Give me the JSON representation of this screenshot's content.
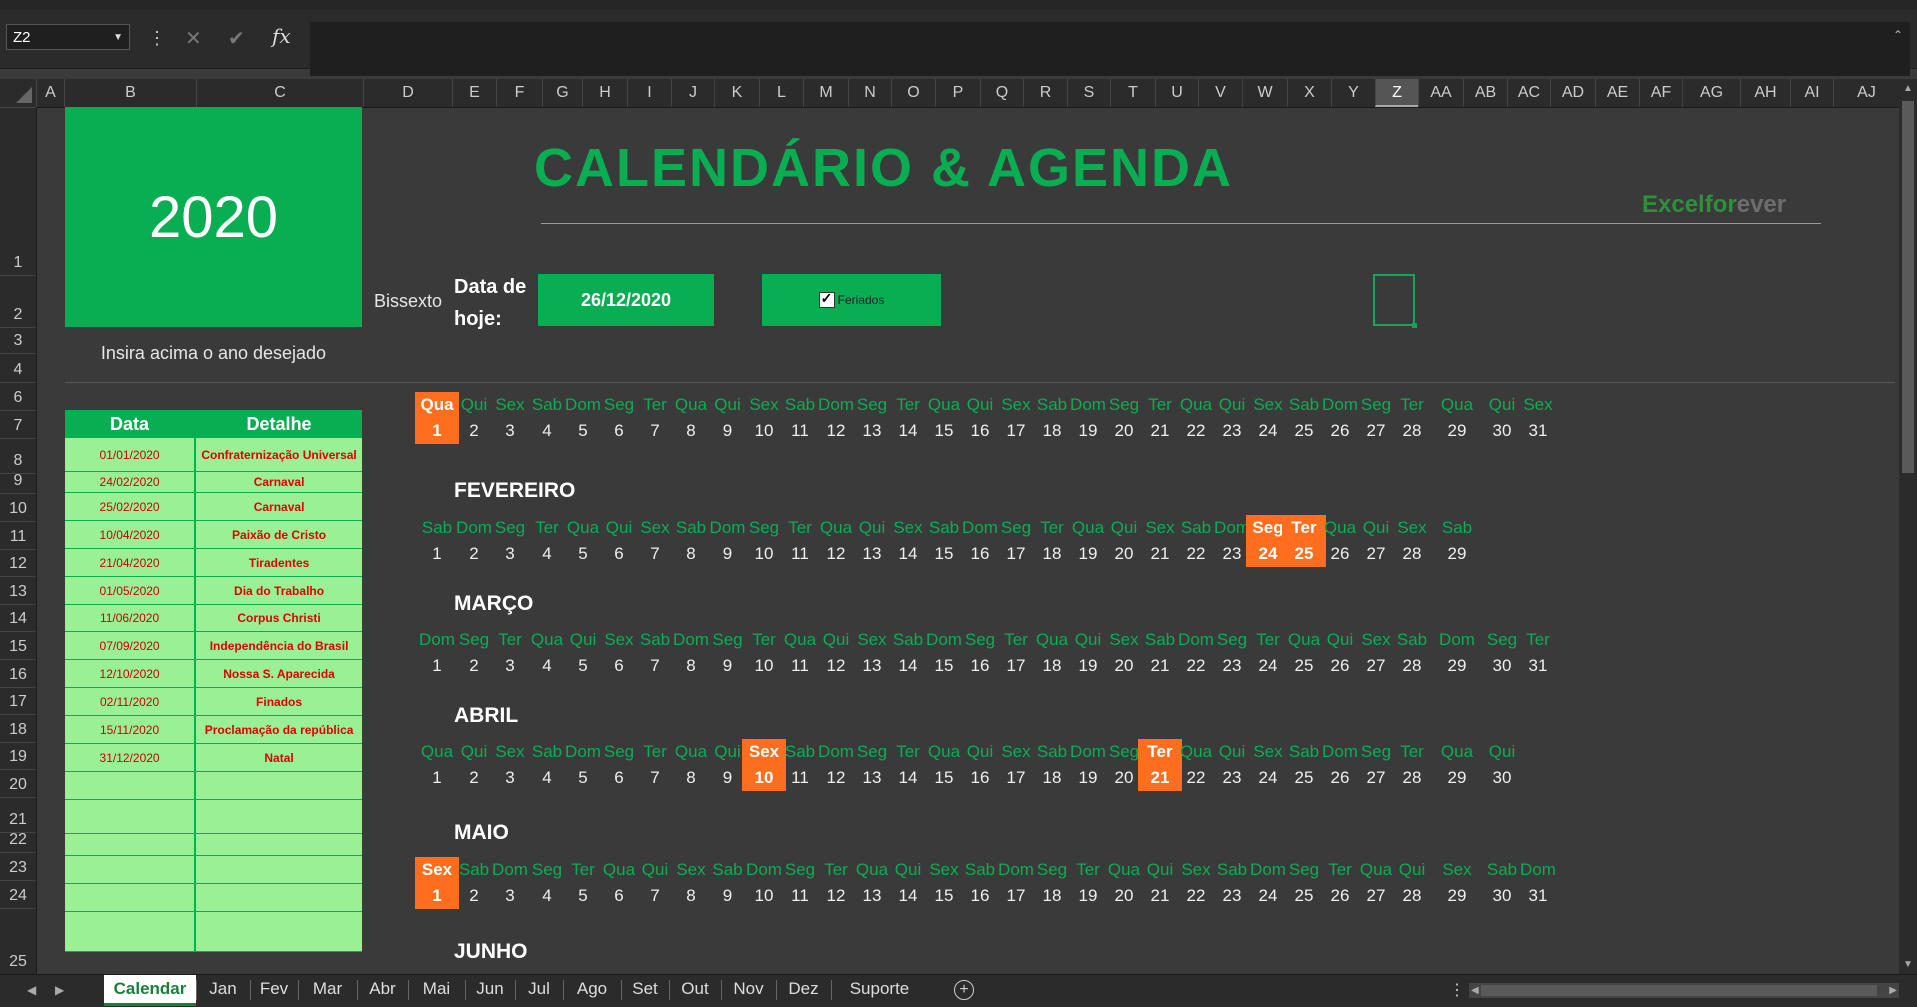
{
  "formula_bar": {
    "name_box": "Z2",
    "fx": "fx",
    "content": ""
  },
  "columns": [
    "A",
    "B",
    "C",
    "D",
    "E",
    "F",
    "G",
    "H",
    "I",
    "J",
    "K",
    "L",
    "M",
    "N",
    "O",
    "P",
    "Q",
    "R",
    "S",
    "T",
    "U",
    "V",
    "W",
    "X",
    "Y",
    "Z",
    "AA",
    "AB",
    "AC",
    "AD",
    "AE",
    "AF",
    "AG",
    "AH",
    "AI",
    "AJ"
  ],
  "active_column": "Z",
  "rows": [
    "1",
    "2",
    "3",
    "4",
    "6",
    "7",
    "8",
    "9",
    "10",
    "11",
    "12",
    "13",
    "14",
    "15",
    "16",
    "17",
    "18",
    "19",
    "20",
    "21",
    "22",
    "23",
    "24",
    "25"
  ],
  "sheet": {
    "year": "2020",
    "year_hint": "Insira acima o ano desejado",
    "title": "CALENDÁRIO & AGENDA",
    "brand_main": "Excelfor",
    "brand_suffix": "ever",
    "bissexto_label": "Bissexto",
    "today_label": "Data de hoje:",
    "today_value": "26/12/2020",
    "feriados_checkbox": "Feriados"
  },
  "holidays": {
    "headers": [
      "Data",
      "Detalhe"
    ],
    "rows": [
      {
        "date": "01/01/2020",
        "detail": "Confraternização Universal"
      },
      {
        "date": "24/02/2020",
        "detail": "Carnaval"
      },
      {
        "date": "25/02/2020",
        "detail": "Carnaval"
      },
      {
        "date": "10/04/2020",
        "detail": "Paixão de Cristo"
      },
      {
        "date": "21/04/2020",
        "detail": "Tiradentes"
      },
      {
        "date": "01/05/2020",
        "detail": "Dia do Trabalho"
      },
      {
        "date": "11/06/2020",
        "detail": "Corpus Christi"
      },
      {
        "date": "07/09/2020",
        "detail": "Independência do Brasil"
      },
      {
        "date": "12/10/2020",
        "detail": "Nossa S. Aparecida"
      },
      {
        "date": "02/11/2020",
        "detail": "Finados"
      },
      {
        "date": "15/11/2020",
        "detail": "Proclamação da república"
      },
      {
        "date": "31/12/2020",
        "detail": "Natal"
      },
      {
        "date": "",
        "detail": ""
      },
      {
        "date": "",
        "detail": ""
      },
      {
        "date": "",
        "detail": ""
      },
      {
        "date": "",
        "detail": ""
      },
      {
        "date": "",
        "detail": ""
      },
      {
        "date": "",
        "detail": ""
      }
    ]
  },
  "months": [
    {
      "name": "",
      "weekdays": [
        "Qua",
        "Qui",
        "Sex",
        "Sab",
        "Dom",
        "Seg",
        "Ter",
        "Qua",
        "Qui",
        "Sex",
        "Sab",
        "Dom",
        "Seg",
        "Ter",
        "Qua",
        "Qui",
        "Sex",
        "Sab",
        "Dom",
        "Seg",
        "Ter",
        "Qua",
        "Qui",
        "Sex",
        "Sab",
        "Dom",
        "Seg",
        "Ter",
        "Qua",
        "Qui",
        "Sex"
      ],
      "highlight": [
        1
      ]
    },
    {
      "name": "FEVEREIRO",
      "weekdays": [
        "Sab",
        "Dom",
        "Seg",
        "Ter",
        "Qua",
        "Qui",
        "Sex",
        "Sab",
        "Dom",
        "Seg",
        "Ter",
        "Qua",
        "Qui",
        "Sex",
        "Sab",
        "Dom",
        "Seg",
        "Ter",
        "Qua",
        "Qui",
        "Sex",
        "Sab",
        "Dom",
        "Seg",
        "Ter",
        "Qua",
        "Qui",
        "Sex",
        "Sab"
      ],
      "highlight": [
        24,
        25
      ]
    },
    {
      "name": "MARÇO",
      "weekdays": [
        "Dom",
        "Seg",
        "Ter",
        "Qua",
        "Qui",
        "Sex",
        "Sab",
        "Dom",
        "Seg",
        "Ter",
        "Qua",
        "Qui",
        "Sex",
        "Sab",
        "Dom",
        "Seg",
        "Ter",
        "Qua",
        "Qui",
        "Sex",
        "Sab",
        "Dom",
        "Seg",
        "Ter",
        "Qua",
        "Qui",
        "Sex",
        "Sab",
        "Dom",
        "Seg",
        "Ter"
      ],
      "highlight": []
    },
    {
      "name": "ABRIL",
      "weekdays": [
        "Qua",
        "Qui",
        "Sex",
        "Sab",
        "Dom",
        "Seg",
        "Ter",
        "Qua",
        "Qui",
        "Sex",
        "Sab",
        "Dom",
        "Seg",
        "Ter",
        "Qua",
        "Qui",
        "Sex",
        "Sab",
        "Dom",
        "Seg",
        "Ter",
        "Qua",
        "Qui",
        "Sex",
        "Sab",
        "Dom",
        "Seg",
        "Ter",
        "Qua",
        "Qui"
      ],
      "highlight": [
        10,
        21
      ]
    },
    {
      "name": "MAIO",
      "weekdays": [
        "Sex",
        "Sab",
        "Dom",
        "Seg",
        "Ter",
        "Qua",
        "Qui",
        "Sex",
        "Sab",
        "Dom",
        "Seg",
        "Ter",
        "Qua",
        "Qui",
        "Sex",
        "Sab",
        "Dom",
        "Seg",
        "Ter",
        "Qua",
        "Qui",
        "Sex",
        "Sab",
        "Dom",
        "Seg",
        "Ter",
        "Qua",
        "Qui",
        "Sex",
        "Sab",
        "Dom"
      ],
      "highlight": [
        1
      ]
    },
    {
      "name": "JUNHO",
      "weekdays": [],
      "highlight": []
    }
  ],
  "tabs": [
    "Calendar",
    "Jan",
    "Fev",
    "Mar",
    "Abr",
    "Mai",
    "Jun",
    "Jul",
    "Ago",
    "Set",
    "Out",
    "Nov",
    "Dez",
    "Suporte"
  ],
  "active_tab": "Calendar",
  "colors": {
    "green": "#0aae52",
    "holiday": "#ff6d1f",
    "table_bg": "#9af195",
    "background": "#3a3a3a"
  }
}
